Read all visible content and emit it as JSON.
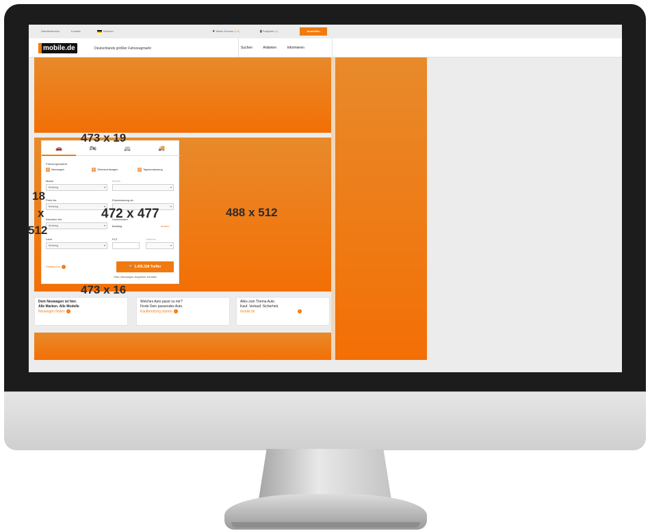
{
  "topbar": {
    "links": [
      "Händlerbereich",
      "Kontakt",
      "Deutsch"
    ],
    "saved_searches": "Meine Suchen",
    "saved_searches_count": "(1/3)",
    "parked": "Parkplatz",
    "parked_count": "(0)",
    "login": "Anmelden"
  },
  "header": {
    "logo": "mobile.de",
    "tagline": "Deutschlands größter Fahrzeugmarkt",
    "nav": [
      "Suchen",
      "Anbieten",
      "Informieren"
    ]
  },
  "dimensions": {
    "top_label": "473 x 19",
    "panel_label": "472 x 477",
    "side_label": "488 x 512",
    "bottom_label": "473 x 16",
    "left_a": "18",
    "left_x": "x",
    "left_b": "512"
  },
  "search": {
    "tabs": [
      "car-icon",
      "motorbike-icon",
      "caravan-icon",
      "truck-icon"
    ],
    "condition_label": "Fahrzeugzustand",
    "conditions": [
      "Neuwagen",
      "Gebrauchtwagen",
      "Tageszulassung"
    ],
    "make_label": "Marke",
    "make_value": "Beliebig",
    "model_label": "Modell",
    "price_label": "Preis bis",
    "price_value": "Beliebig",
    "first_reg_label": "Erstzulassung ab",
    "mileage_label": "Kilometer bis",
    "mileage_value": "Beliebig",
    "location_label": "Kaufstandort",
    "location_value": "Beliebig",
    "location_change": "ändern",
    "country_label": "Land",
    "country_value": "Beliebig",
    "zip_label": "PLZ",
    "radius_label": "Umkreis",
    "detail_search": "Detailsuche",
    "results_button": "1.435.338 Treffer",
    "under_button": "Oder Neuwagen-Angebote erhalten"
  },
  "promos": [
    {
      "line1": "Dein Neuwagen ist hier.",
      "line2": "Alle Marken. Alle Modelle",
      "cta": "Neuwagen finden"
    },
    {
      "line1": "Welches Auto passt zu mir?",
      "line2": "Finde Dein passendes Auto.",
      "cta": "Kaufberatung starten"
    },
    {
      "line1": "Alles zum Thema Auto.",
      "line2": "Kauf. Verkauf. Sicherheit.",
      "cta": "mobile.de"
    }
  ]
}
